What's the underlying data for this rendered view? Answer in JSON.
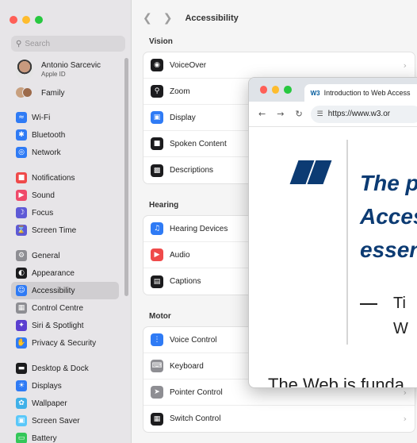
{
  "sidebar": {
    "search_placeholder": "Search",
    "account": {
      "name": "Antonio Sarcevic",
      "sub": "Apple ID"
    },
    "family_label": "Family",
    "groups": [
      [
        {
          "label": "Wi-Fi",
          "icon": "wifi-icon",
          "color": "#2f7bf5"
        },
        {
          "label": "Bluetooth",
          "icon": "bluetooth-icon",
          "color": "#2f7bf5"
        },
        {
          "label": "Network",
          "icon": "globe-icon",
          "color": "#2f7bf5"
        }
      ],
      [
        {
          "label": "Notifications",
          "icon": "bell-icon",
          "color": "#ef4a4a"
        },
        {
          "label": "Sound",
          "icon": "speaker-icon",
          "color": "#ef4a6a"
        },
        {
          "label": "Focus",
          "icon": "moon-icon",
          "color": "#5e5ad6"
        },
        {
          "label": "Screen Time",
          "icon": "hourglass-icon",
          "color": "#5e5ad6"
        }
      ],
      [
        {
          "label": "General",
          "icon": "gear-icon",
          "color": "#8e8e93"
        },
        {
          "label": "Appearance",
          "icon": "appearance-icon",
          "color": "#1c1c1e"
        },
        {
          "label": "Accessibility",
          "icon": "accessibility-icon",
          "color": "#2f7bf5"
        },
        {
          "label": "Control Centre",
          "icon": "control-centre-icon",
          "color": "#8e8e93"
        },
        {
          "label": "Siri & Spotlight",
          "icon": "siri-icon",
          "color": "#5b3fd0"
        },
        {
          "label": "Privacy & Security",
          "icon": "hand-icon",
          "color": "#2f7bf5"
        }
      ],
      [
        {
          "label": "Desktop & Dock",
          "icon": "dock-icon",
          "color": "#1c1c1e"
        },
        {
          "label": "Displays",
          "icon": "sun-icon",
          "color": "#2f7bf5"
        },
        {
          "label": "Wallpaper",
          "icon": "flower-icon",
          "color": "#3fb0e8"
        },
        {
          "label": "Screen Saver",
          "icon": "screensaver-icon",
          "color": "#5ac8fa"
        },
        {
          "label": "Battery",
          "icon": "battery-icon",
          "color": "#34c759"
        }
      ]
    ]
  },
  "main": {
    "title": "Accessibility",
    "sections": [
      {
        "title": "Vision",
        "items": [
          {
            "label": "VoiceOver",
            "icon": "voiceover-icon",
            "color": "#1c1c1e"
          },
          {
            "label": "Zoom",
            "icon": "zoom-icon",
            "color": "#1c1c1e"
          },
          {
            "label": "Display",
            "icon": "display-icon",
            "color": "#2f7bf5"
          },
          {
            "label": "Spoken Content",
            "icon": "speech-bubble-icon",
            "color": "#1c1c1e"
          },
          {
            "label": "Descriptions",
            "icon": "descriptions-icon",
            "color": "#1c1c1e"
          }
        ]
      },
      {
        "title": "Hearing",
        "items": [
          {
            "label": "Hearing Devices",
            "icon": "ear-icon",
            "color": "#2f7bf5"
          },
          {
            "label": "Audio",
            "icon": "audio-icon",
            "color": "#ef4a4a"
          },
          {
            "label": "Captions",
            "icon": "captions-icon",
            "color": "#1c1c1e"
          }
        ]
      },
      {
        "title": "Motor",
        "items": [
          {
            "label": "Voice Control",
            "icon": "voice-control-icon",
            "color": "#2f7bf5"
          },
          {
            "label": "Keyboard",
            "icon": "keyboard-icon",
            "color": "#8e8e93"
          },
          {
            "label": "Pointer Control",
            "icon": "pointer-icon",
            "color": "#8e8e93"
          },
          {
            "label": "Switch Control",
            "icon": "switch-icon",
            "color": "#1c1c1e"
          }
        ]
      }
    ]
  },
  "browser": {
    "tab_title": "Introduction to Web Access",
    "tab_favicon": "W3",
    "url": "https://www.w3.or",
    "quote_lines": [
      "The p",
      "Acces",
      "essen"
    ],
    "attribution_lines": [
      "Ti",
      "W"
    ],
    "body_text": "The Web is funda"
  }
}
